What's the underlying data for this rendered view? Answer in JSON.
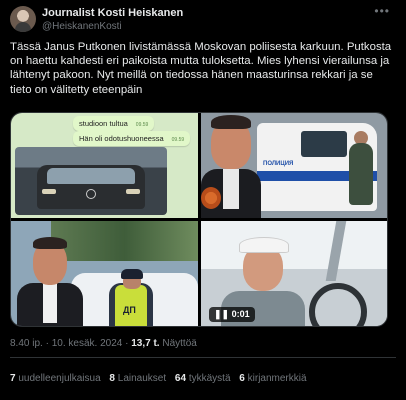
{
  "author": {
    "name": "Journalist Kosti Heiskanen",
    "handle": "@HeiskanenKosti"
  },
  "tweet": {
    "text": "Tässä Janus Putkonen livistämässä Moskovan poliisesta karkuun. Putkosta on haettu kahdesti eri paikoista mutta tuloksetta. Mies lyhensi vierailunsa ja lähtenyt pakoon. Nyt meillä on tiedossa hänen maasturinsa rekkari ja se tieto on välitetty eteenpäin"
  },
  "media": {
    "chat_bubble_1": "studioon tultua",
    "chat_bubble_1_time": "09.59",
    "chat_bubble_2": "Hän oli odotushuoneessa",
    "chat_bubble_2_time": "09.59",
    "van_text": "ПОЛИЦИЯ",
    "officer_vest_text": "ДП",
    "video_duration": "0:01"
  },
  "meta": {
    "time": "8.40 ip.",
    "date": "10. kesäk. 2024",
    "separator": "·",
    "views_count": "13,7 t.",
    "views_label": "Näyttöä"
  },
  "stats": {
    "reposts_count": "7",
    "reposts_label": "uudelleenjulkaisua",
    "quotes_count": "8",
    "quotes_label": "Lainaukset",
    "likes_count": "64",
    "likes_label": "tykkäystä",
    "bookmarks_count": "6",
    "bookmarks_label": "kirjanmerkkiä"
  },
  "icons": {
    "more": "more-horizontal-icon",
    "play": "pause-icon"
  }
}
